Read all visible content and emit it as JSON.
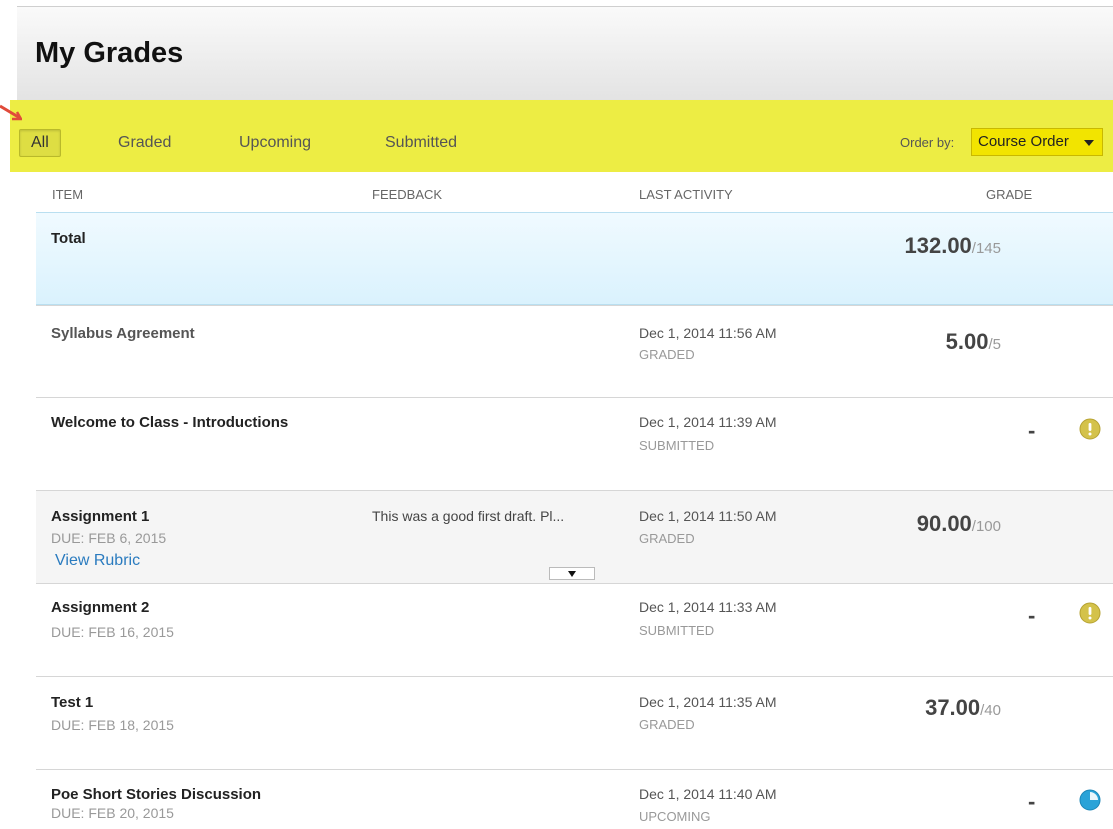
{
  "header": {
    "title": "My Grades"
  },
  "filters": {
    "tabs": [
      "All",
      "Graded",
      "Upcoming",
      "Submitted"
    ],
    "order_by_label": "Order by:",
    "order_by_value": "Course Order"
  },
  "columns": {
    "item": "ITEM",
    "feedback": "FEEDBACK",
    "last_activity": "LAST ACTIVITY",
    "grade": "GRADE"
  },
  "total": {
    "label": "Total",
    "score": "132.00",
    "out_of": "/145"
  },
  "rows": [
    {
      "title": "Syllabus Agreement",
      "activity": "Dec 1, 2014 11:56 AM",
      "status": "GRADED",
      "score": "5.00",
      "out_of": "/5"
    },
    {
      "title": "Welcome to Class - Introductions",
      "activity": "Dec 1, 2014 11:39 AM",
      "status": "SUBMITTED",
      "score": "-",
      "icon": "warning-icon"
    },
    {
      "title": "Assignment 1",
      "due": "DUE: FEB 6, 2015",
      "rubric": "View Rubric",
      "feedback": "This was a good first draft. Pl...",
      "activity": "Dec 1, 2014 11:50 AM",
      "status": "GRADED",
      "score": "90.00",
      "out_of": "/100"
    },
    {
      "title": "Assignment 2",
      "due": "DUE: FEB 16, 2015",
      "activity": "Dec 1, 2014 11:33 AM",
      "status": "SUBMITTED",
      "score": "-",
      "icon": "warning-icon"
    },
    {
      "title": "Test 1",
      "due": "DUE: FEB 18, 2015",
      "activity": "Dec 1, 2014 11:35 AM",
      "status": "GRADED",
      "score": "37.00",
      "out_of": "/40"
    },
    {
      "title": "Poe Short Stories Discussion",
      "due": "DUE: FEB 20, 2015",
      "activity": "Dec 1, 2014 11:40 AM",
      "status": "UPCOMING",
      "score": "-",
      "icon": "upcoming-icon"
    }
  ],
  "colors": {
    "highlight": "#eded44",
    "link": "#2a7bbf",
    "total_bg": "#daf2fd",
    "warning": "#d4c24a",
    "upcoming": "#2aa3d8"
  }
}
